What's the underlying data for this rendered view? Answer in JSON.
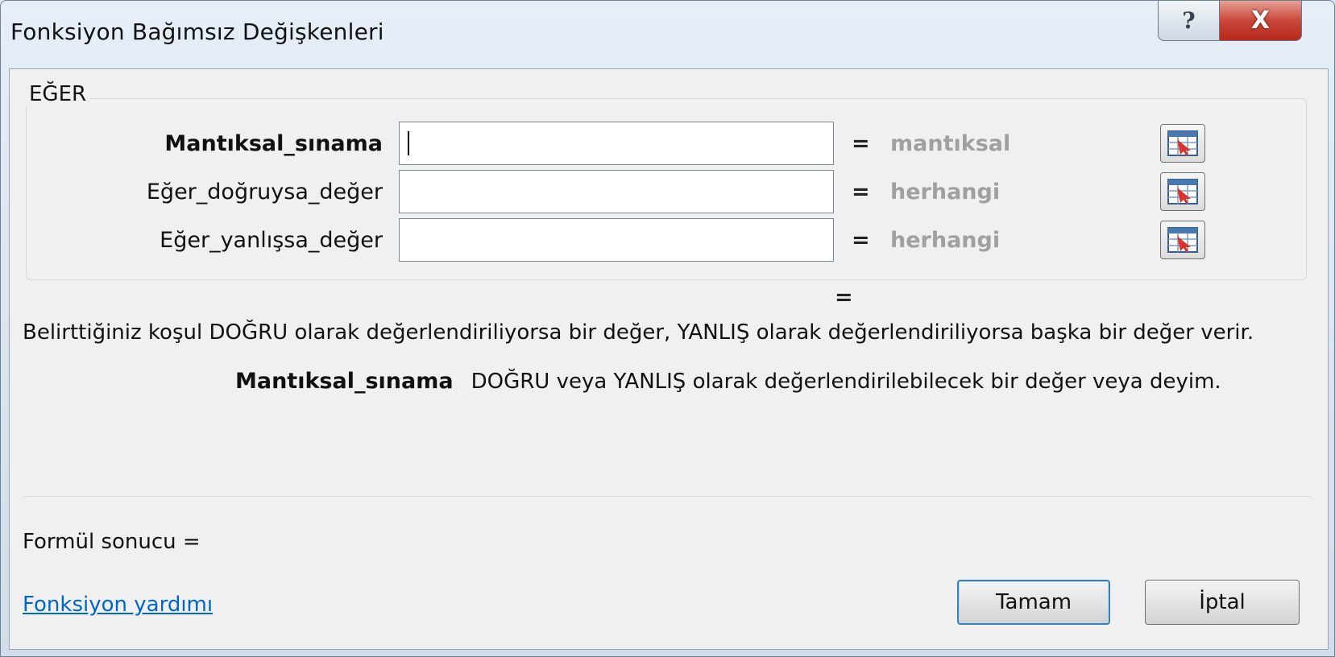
{
  "window": {
    "title": "Fonksiyon Bağımsız Değişkenleri",
    "help_glyph": "?",
    "close_glyph": "X"
  },
  "function_group": {
    "name": "EĞER",
    "arguments": [
      {
        "label": "Mantıksal_sınama",
        "value": "",
        "result": "mantıksal",
        "active": true
      },
      {
        "label": "Eğer_doğruysa_değer",
        "value": "",
        "result": "herhangi",
        "active": false
      },
      {
        "label": "Eğer_yanlışsa_değer",
        "value": "",
        "result": "herhangi",
        "active": false
      }
    ],
    "equals": "="
  },
  "function_result_equals": "=",
  "description": "Belirttiğiniz koşul DOĞRU olarak değerlendiriliyorsa bir değer, YANLIŞ olarak değerlendiriliyorsa başka bir değer verir.",
  "argument_help": {
    "name": "Mantıksal_sınama",
    "text": "DOĞRU veya YANLIŞ olarak değerlendirilebilecek bir değer veya deyim."
  },
  "formula_result": "Formül sonucu =",
  "help_link": "Fonksiyon yardımı",
  "buttons": {
    "ok": "Tamam",
    "cancel": "İptal"
  },
  "icons": {
    "ref_button": "range-select-icon"
  },
  "colors": {
    "link": "#0066cc",
    "result_gray": "#a0a0a0",
    "default_button_border": "#3c7fb1",
    "close_button": "#c8483a"
  }
}
